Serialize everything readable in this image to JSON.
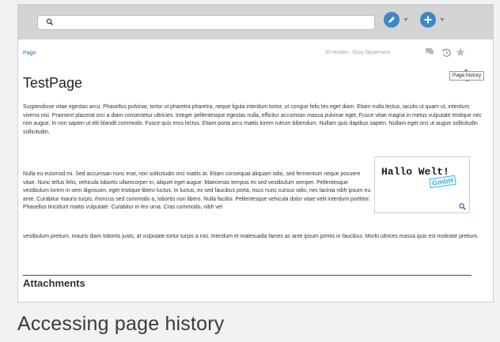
{
  "page": {
    "breadcrumb": "Page",
    "meta": "20 minutes - Sissy Oppermann",
    "tooltip": "Page history",
    "title": "TestPage",
    "paragraphs": [
      "Suspendisse vitae egestas arcu. Phasellus pulvinar, tortor ut pharetra pharetra, neque ligula interdum tortor, ut congue felis leo eget diam. Etiam nulla lectus, iaculis ut quam ut, interdum viverra nisi. Praesent placerat orci a diam consectetur ultricies. Integer pellentesque egestas nulla, efficitur accumsan massa pulvinar eget. Fusce vitae magna in metus vulputate tristique nec non augue. In non sapien ut elit blandit commodo. Fusce quis eros lectus. Etiam porta arcu mattis lorem rutrum bibendum. Nullam quis dapibus sapien. Nullam eget orci ut augue sollicitudin sollicitudin.",
      "Nulla eu euismod mi. Sed accumsan nunc erat, non sollicitudin orci mattis at. Etiam consequat aliquam odio, sed fermentum neque posuere vitae. Nunc tellus felis, vehicula lobortis ullamcorper in, aliquet eget augue. Maecenas tempus mi sed vestibulum semper. Pellentesque vestibulum lorem in sem dignissim, eget tristique libero luctus. In luctus, ex sed faucibus porta, risus nunc cursus odio, nec lacinia nibh ipsum eu ante. Curabitur mauris turpis, rhoncus sed commodo a, lobortis non libero. Nulla facilisi. Pellentesque vehicula dolor vitae velit interdum porttitor. Phasellus tincidunt mattis vulputate. Curabitur in leo urna. Cras commodo, nibh vel",
      "vestibulum pretium, mauris diam lobortis justo, at vulputate tortor turpis a nisi. Interdum et malesuada fames ac ante ipsum primis in faucibus. Morbi ultrices massa quis est molestie pretium."
    ],
    "image": {
      "line1": "Hallo Welt!",
      "line2": "GmbH"
    },
    "attachments": "Attachments"
  },
  "caption": "Accessing page history",
  "colors": {
    "accent": "#3f87c7",
    "link": "#2f6db5",
    "topbar": "#d4d4d4"
  },
  "icons": [
    "search-icon",
    "edit-icon",
    "add-icon",
    "comments-icon",
    "history-icon",
    "star-icon",
    "zoom-icon",
    "hand-cursor-icon"
  ]
}
